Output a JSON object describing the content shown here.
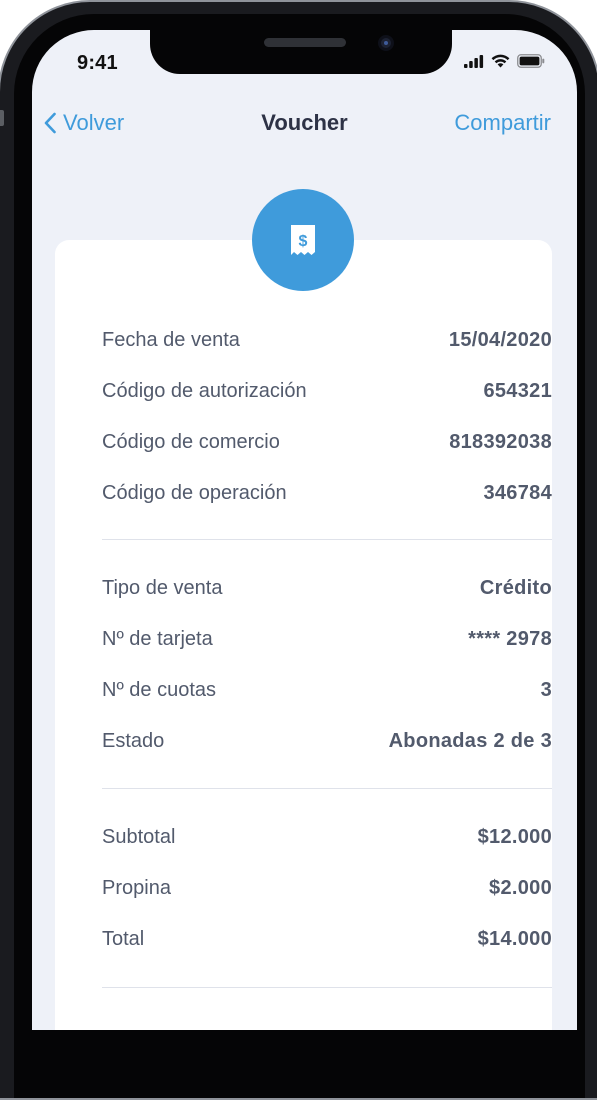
{
  "status_bar": {
    "time": "9:41"
  },
  "nav": {
    "back_label": "Volver",
    "title": "Voucher",
    "share_label": "Compartir"
  },
  "badge": {
    "icon": "receipt-dollar-icon",
    "symbol": "$"
  },
  "sale_details": [
    {
      "label": "Fecha de venta",
      "value": "15/04/2020"
    },
    {
      "label": "Código de autorización",
      "value": "654321"
    },
    {
      "label": "Código de comercio",
      "value": "818392038"
    },
    {
      "label": "Código de operación",
      "value": "346784"
    }
  ],
  "payment_details": [
    {
      "label": "Tipo de venta",
      "value": "Crédito"
    },
    {
      "label": "Nº de tarjeta",
      "value": "**** 2978"
    },
    {
      "label": "Nº de cuotas",
      "value": "3"
    },
    {
      "label": "Estado",
      "value": "Abonadas 2 de 3"
    }
  ],
  "totals": [
    {
      "label": "Subtotal",
      "value": "$12.000"
    },
    {
      "label": "Propina",
      "value": "$2.000"
    },
    {
      "label": "Total",
      "value": "$14.000"
    }
  ],
  "colors": {
    "accent": "#3f9bdb",
    "background": "#eef1f8",
    "text": "#525a6c",
    "title": "#2d3246"
  }
}
